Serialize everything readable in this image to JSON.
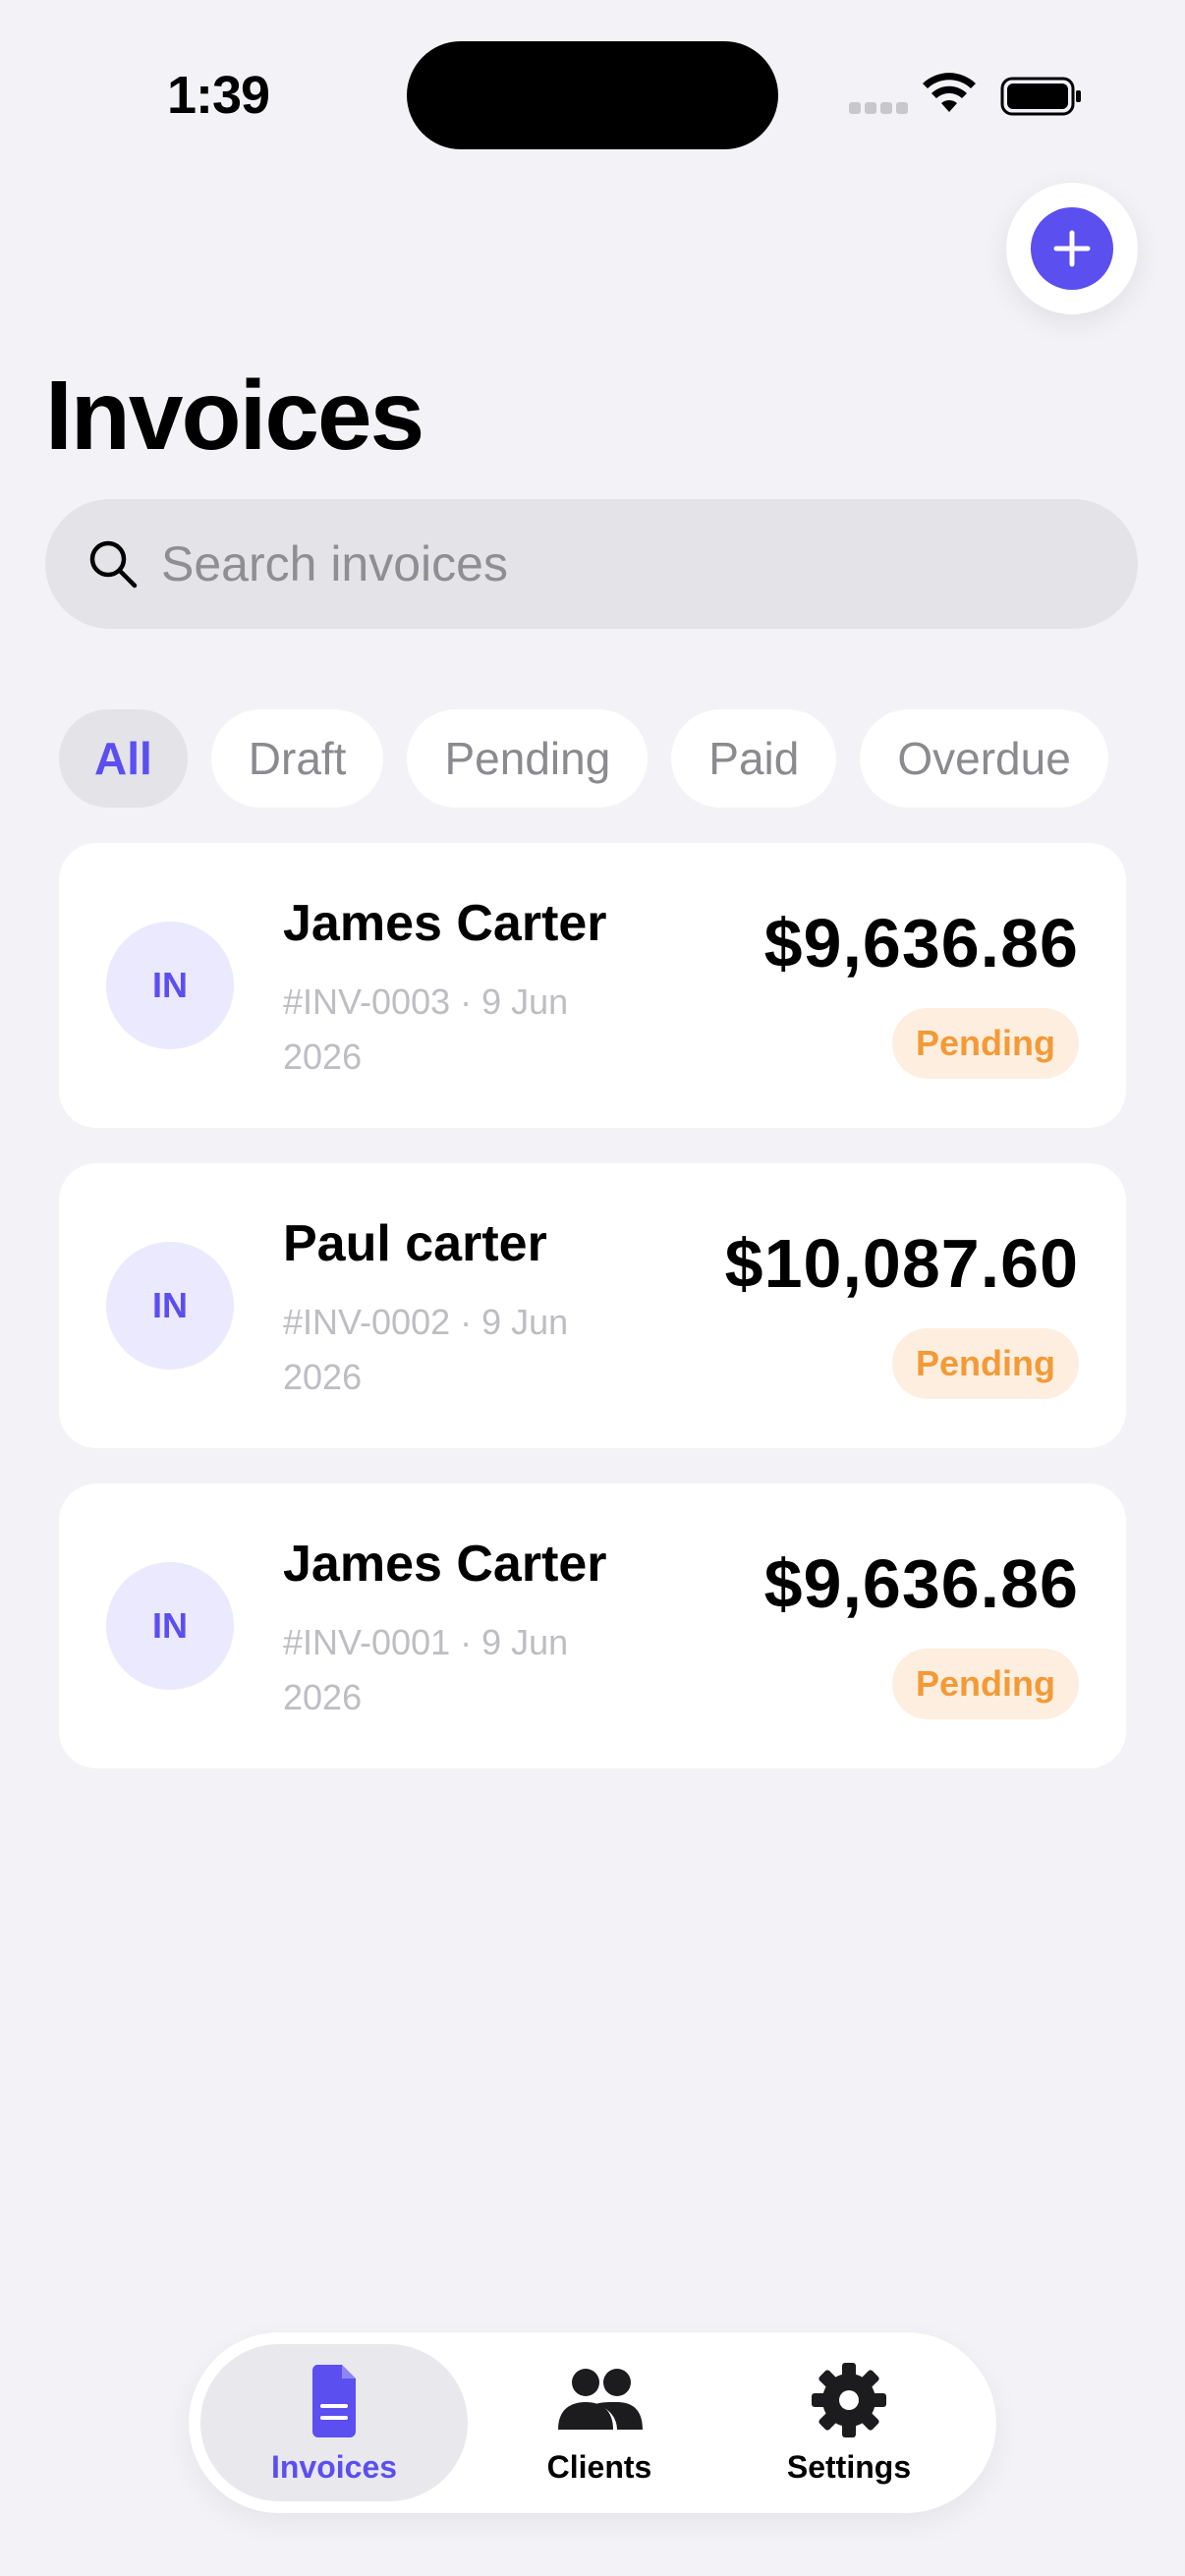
{
  "status_bar": {
    "time": "1:39"
  },
  "header": {
    "title": "Invoices"
  },
  "search": {
    "placeholder": "Search invoices",
    "value": ""
  },
  "filters": [
    {
      "label": "All",
      "active": true
    },
    {
      "label": "Draft",
      "active": false
    },
    {
      "label": "Pending",
      "active": false
    },
    {
      "label": "Paid",
      "active": false
    },
    {
      "label": "Overdue",
      "active": false
    }
  ],
  "invoices": [
    {
      "initials": "IN",
      "client": "James Carter",
      "meta": "#INV-0003 · 9 Jun 2026",
      "amount": "$9,636.86",
      "status": "Pending"
    },
    {
      "initials": "IN",
      "client": "Paul carter",
      "meta": "#INV-0002 · 9 Jun 2026",
      "amount": "$10,087.60",
      "status": "Pending"
    },
    {
      "initials": "IN",
      "client": "James Carter",
      "meta": "#INV-0001 · 9 Jun 2026",
      "amount": "$9,636.86",
      "status": "Pending"
    }
  ],
  "tabbar": {
    "tabs": [
      {
        "label": "Invoices",
        "icon": "document-icon",
        "active": true
      },
      {
        "label": "Clients",
        "icon": "people-icon",
        "active": false
      },
      {
        "label": "Settings",
        "icon": "gear-icon",
        "active": false
      }
    ]
  },
  "colors": {
    "accent": "#5b4ff0",
    "background": "#f2f2f7",
    "pending_text": "#f39a36",
    "pending_bg": "#fdeedf"
  }
}
